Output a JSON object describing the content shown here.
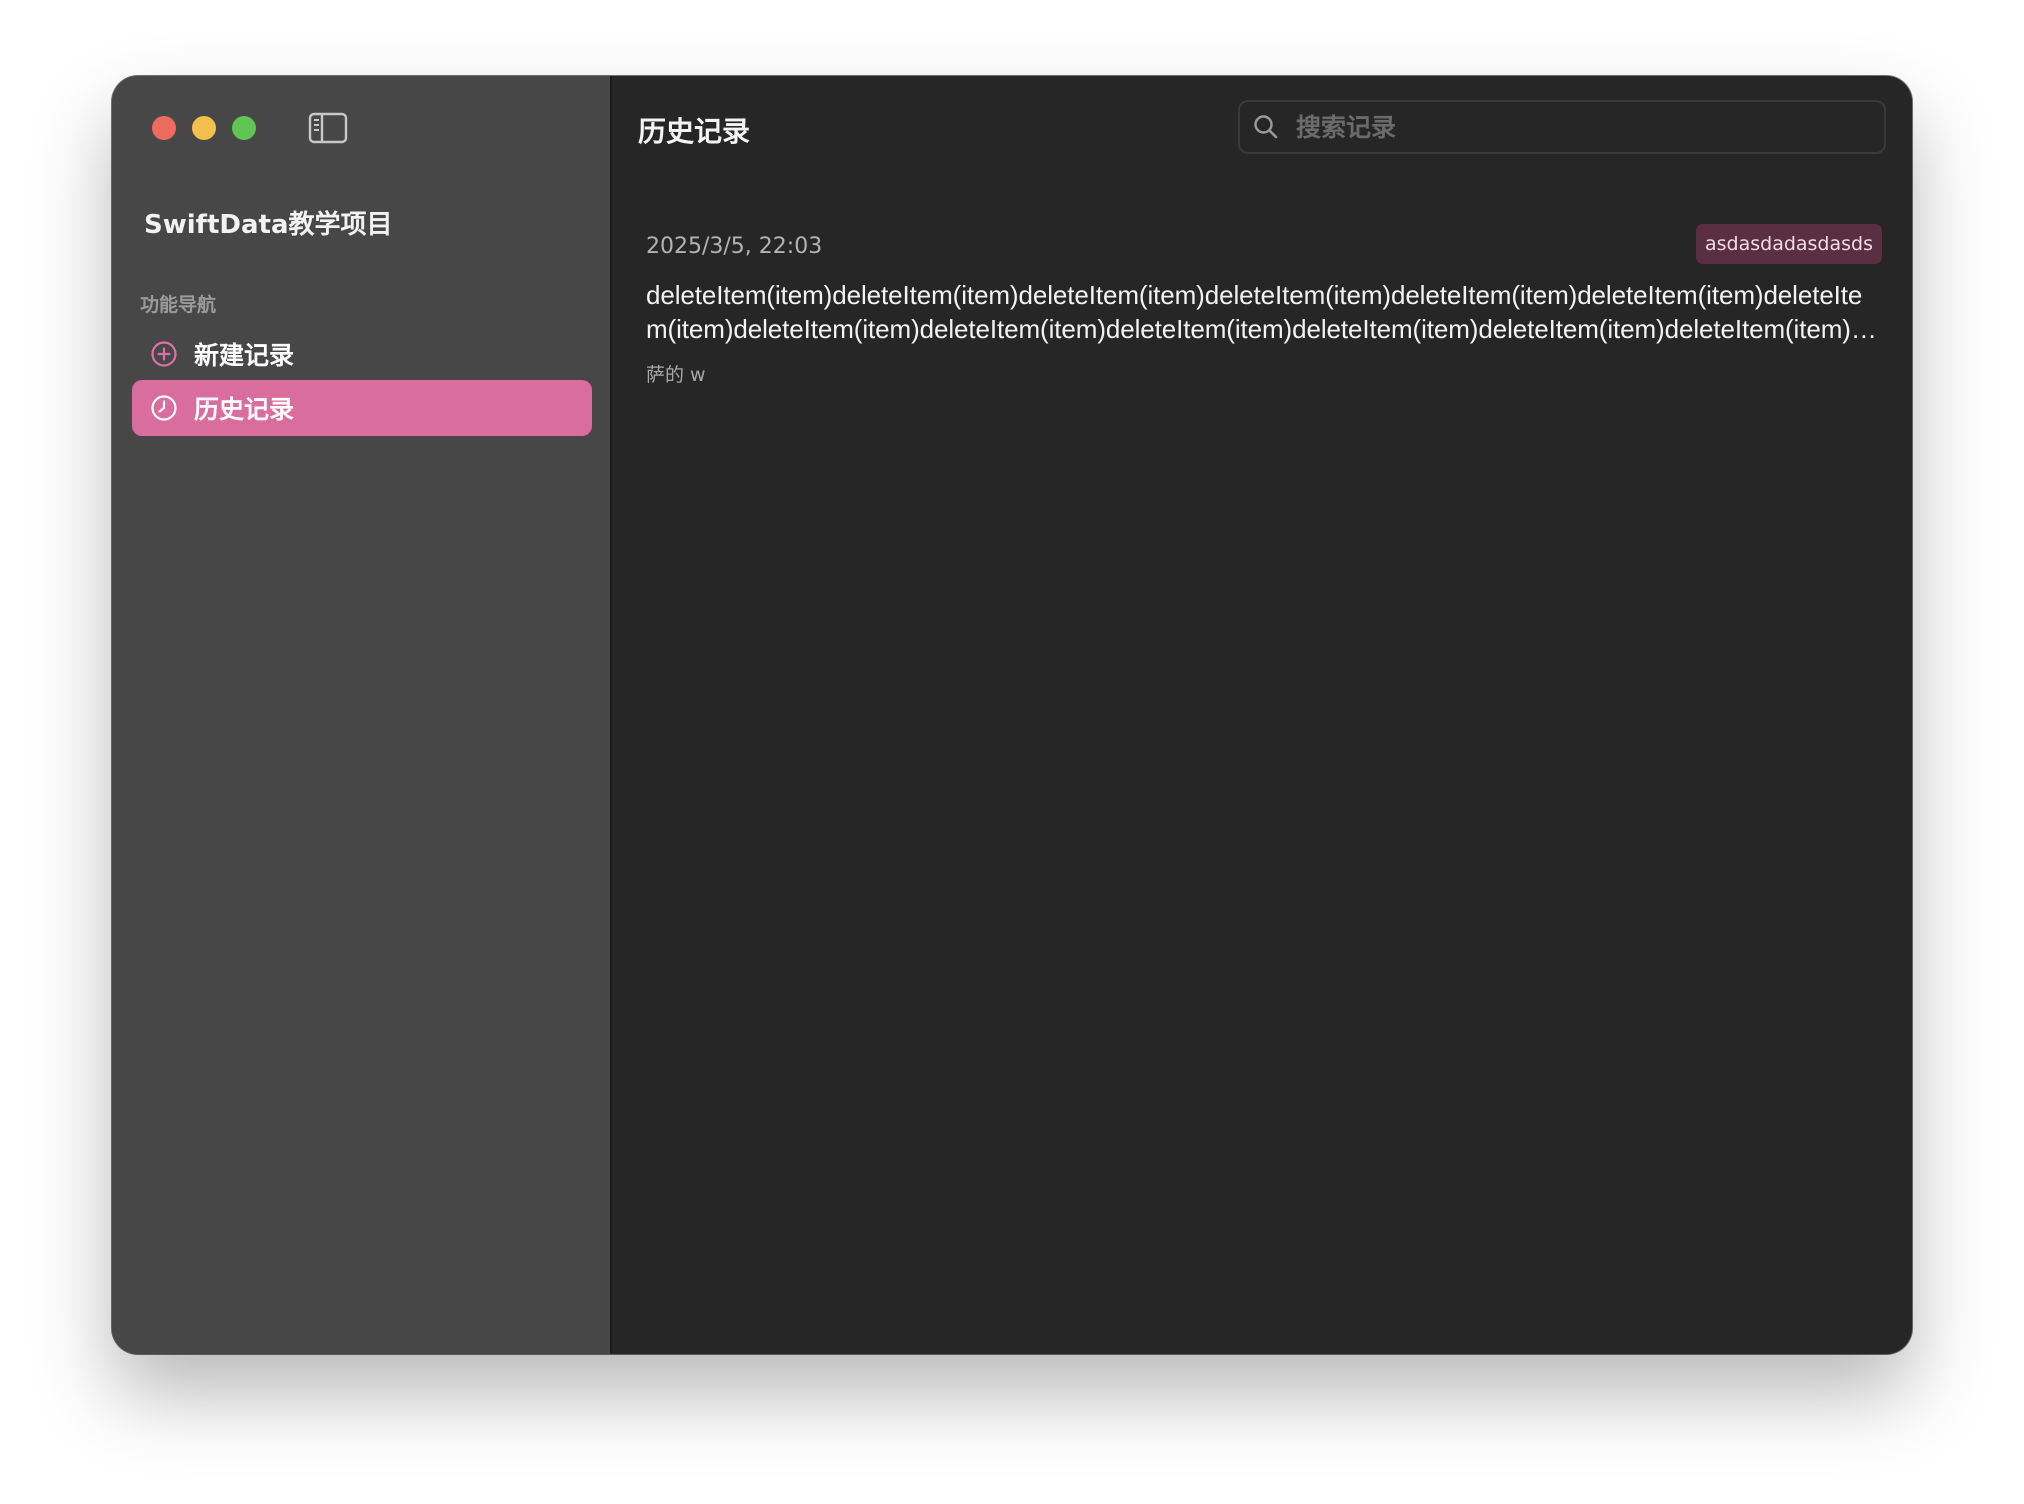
{
  "window": {
    "controls": [
      "close",
      "minimize",
      "maximize"
    ]
  },
  "sidebar": {
    "toggle_icon": "sidebar-toggle-icon",
    "project_title": "SwiftData教学项目",
    "section_label": "功能导航",
    "items": [
      {
        "label": "新建记录",
        "icon": "plus-circle-icon",
        "active": false
      },
      {
        "label": "历史记录",
        "icon": "clock-icon",
        "active": true
      }
    ]
  },
  "main": {
    "title": "历史记录",
    "search": {
      "placeholder": "搜索记录",
      "value": "",
      "icon": "search-icon"
    },
    "records": [
      {
        "date": "2025/3/5, 22:03",
        "tag": "asdasdadasdasds",
        "content": "deleteItem(item)deleteItem(item)deleteItem(item)deleteItem(item)deleteItem(item)deleteItem(item)deleteItem(item)deleteItem(item)deleteItem(item)deleteItem(item)deleteItem(item)deleteItem(item)deleteItem(item)deleteItem(item)",
        "note": "萨的 w"
      }
    ]
  },
  "colors": {
    "accent": "#d96d9d",
    "sidebar_bg": "#474747",
    "main_bg": "#262626",
    "tag_bg": "#5a2f42",
    "close": "#ed6a5e",
    "minimize": "#f5bf4f",
    "maximize": "#61c554"
  }
}
